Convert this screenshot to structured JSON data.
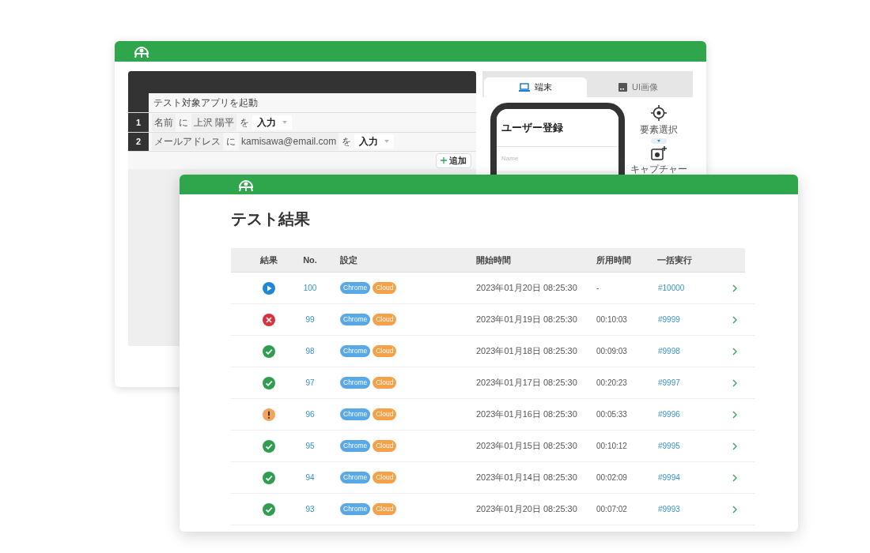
{
  "editor_window": {
    "launch_step": "テスト対象アプリを起動",
    "steps": [
      {
        "number": "1",
        "target": "名前",
        "particle_1": "に",
        "value": "上沢 陽平",
        "particle_2": "を",
        "action": "入力"
      },
      {
        "number": "2",
        "target": "メールアドレス",
        "particle_1": "に",
        "value": "kamisawa@email.com",
        "particle_2": "を",
        "action": "入力"
      }
    ],
    "add_button": "追加",
    "preview_tabs": [
      {
        "label": "端末",
        "selected": true,
        "kind": "device"
      },
      {
        "label": "UI画像",
        "selected": false,
        "kind": "image"
      }
    ],
    "screen_title": "ユーザー登録",
    "field_placeholder": "Name",
    "tools": [
      {
        "label": "要素選択",
        "kind": "target"
      },
      {
        "label": "キャプチャー",
        "kind": "capture"
      }
    ]
  },
  "results_window": {
    "title": "テスト結果",
    "columns": [
      "結果",
      "No.",
      "設定",
      "開始時間",
      "所用時間",
      "一括実行"
    ],
    "rows": [
      {
        "kind": "running",
        "no": "100",
        "tags": [
          {
            "label": "Chrome",
            "color": "#5aa9e6"
          },
          {
            "label": "Cloud",
            "color": "#f6a047"
          }
        ],
        "start": "2023年01月20日 08:25:30",
        "duration": "-",
        "batch": "#10000"
      },
      {
        "kind": "failed",
        "no": "99",
        "tags": [
          {
            "label": "Chrome",
            "color": "#5aa9e6"
          },
          {
            "label": "Cloud",
            "color": "#f6a047"
          }
        ],
        "start": "2023年01月19日 08:25:30",
        "duration": "00:10:03",
        "batch": "#9999"
      },
      {
        "kind": "passed",
        "no": "98",
        "tags": [
          {
            "label": "Chrome",
            "color": "#5aa9e6"
          },
          {
            "label": "Cloud",
            "color": "#f6a047"
          }
        ],
        "start": "2023年01月18日 08:25:30",
        "duration": "00:09:03",
        "batch": "#9998"
      },
      {
        "kind": "passed",
        "no": "97",
        "tags": [
          {
            "label": "Chrome",
            "color": "#5aa9e6"
          },
          {
            "label": "Cloud",
            "color": "#f6a047"
          }
        ],
        "start": "2023年01月17日 08:25:30",
        "duration": "00:20:23",
        "batch": "#9997"
      },
      {
        "kind": "warning",
        "no": "96",
        "tags": [
          {
            "label": "Chrome",
            "color": "#5aa9e6"
          },
          {
            "label": "Cloud",
            "color": "#f6a047"
          }
        ],
        "start": "2023年01月16日 08:25:30",
        "duration": "00:05:33",
        "batch": "#9996"
      },
      {
        "kind": "passed",
        "no": "95",
        "tags": [
          {
            "label": "Chrome",
            "color": "#5aa9e6"
          },
          {
            "label": "Cloud",
            "color": "#f6a047"
          }
        ],
        "start": "2023年01月15日 08:25:30",
        "duration": "00:10:12",
        "batch": "#9995"
      },
      {
        "kind": "passed",
        "no": "94",
        "tags": [
          {
            "label": "Chrome",
            "color": "#5aa9e6"
          },
          {
            "label": "Cloud",
            "color": "#f6a047"
          }
        ],
        "start": "2023年01月14日 08:25:30",
        "duration": "00:02:09",
        "batch": "#9994"
      },
      {
        "kind": "passed",
        "no": "93",
        "tags": [
          {
            "label": "Chrome",
            "color": "#5aa9e6"
          },
          {
            "label": "Cloud",
            "color": "#f6a047"
          }
        ],
        "start": "2023年01月20日 08:25:30",
        "duration": "00:07:02",
        "batch": "#9993"
      }
    ]
  }
}
